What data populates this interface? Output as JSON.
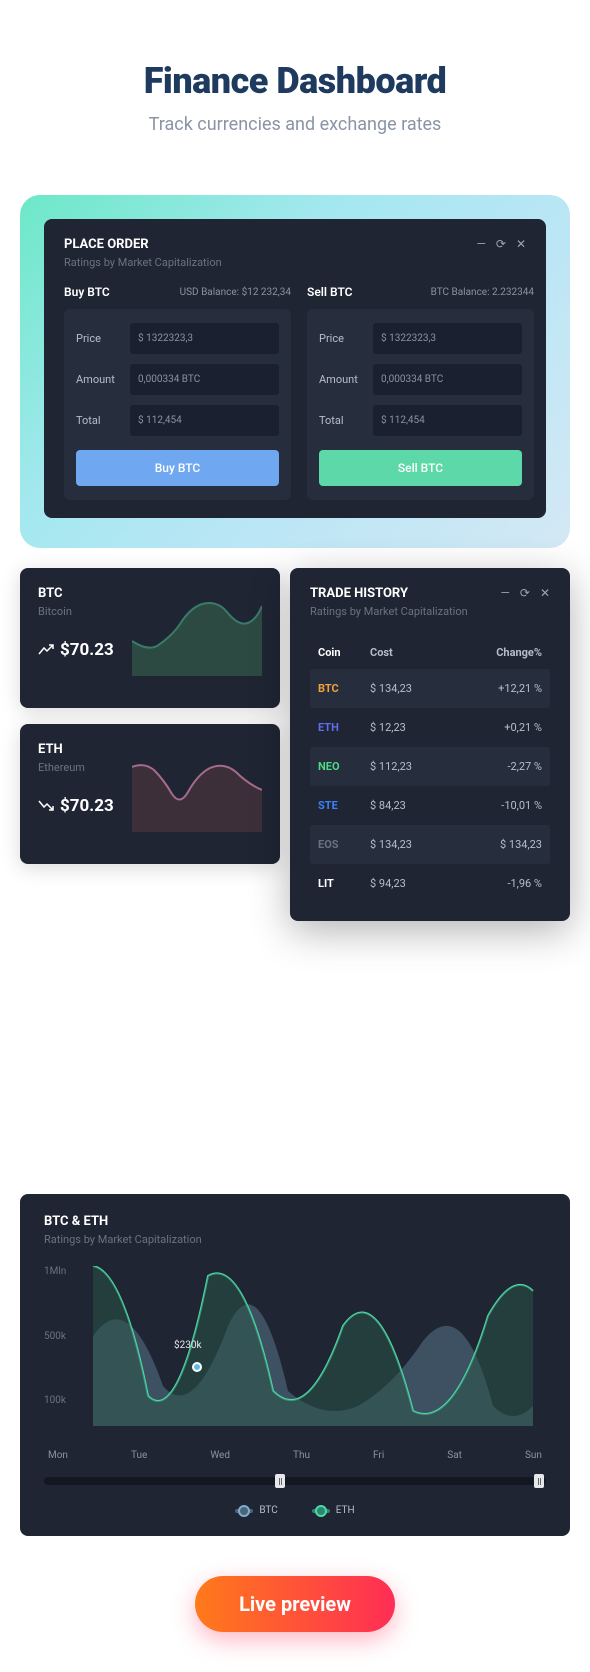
{
  "header": {
    "title": "Finance Dashboard",
    "subtitle": "Track currencies and exchange rates"
  },
  "placeOrder": {
    "title": "PLACE ORDER",
    "subtitle": "Ratings by Market Capitalization",
    "buy": {
      "title": "Buy BTC",
      "balance": "USD Balance: $12 232,34",
      "priceLabel": "Price",
      "priceValue": "$ 1322323,3",
      "amountLabel": "Amount",
      "amountValue": "0,000334 BTC",
      "totalLabel": "Total",
      "totalValue": "$ 112,454",
      "button": "Buy BTC"
    },
    "sell": {
      "title": "Sell BTC",
      "balance": "BTC Balance: 2.232344",
      "priceLabel": "Price",
      "priceValue": "$ 1322323,3",
      "amountLabel": "Amount",
      "amountValue": "0,000334 BTC",
      "totalLabel": "Total",
      "totalValue": "$ 112,454",
      "button": "Sell BTC"
    }
  },
  "miniCards": [
    {
      "symbol": "BTC",
      "name": "Bitcoin",
      "price": "$70.23",
      "trend": "up",
      "color": "#3a7a6a"
    },
    {
      "symbol": "ETH",
      "name": "Ethereum",
      "price": "$70.23",
      "trend": "down",
      "color": "#a56b8a"
    }
  ],
  "tradeHistory": {
    "title": "TRADE HISTORY",
    "subtitle": "Ratings by Market Capitalization",
    "columns": [
      "Coin",
      "Cost",
      "Change%"
    ],
    "rows": [
      {
        "coin": "BTC",
        "cost": "$ 134,23",
        "change": "+12,21 %",
        "class": "c-btc",
        "alt": true
      },
      {
        "coin": "ETH",
        "cost": "$ 12,23",
        "change": "+0,21 %",
        "class": "c-eth",
        "alt": false
      },
      {
        "coin": "NEO",
        "cost": "$ 112,23",
        "change": "-2,27 %",
        "class": "c-neo",
        "alt": true
      },
      {
        "coin": "STE",
        "cost": "$ 84,23",
        "change": "-10,01 %",
        "class": "c-ste",
        "alt": false
      },
      {
        "coin": "EOS",
        "cost": "$ 134,23",
        "change": "$ 134,23",
        "class": "c-eos",
        "alt": true
      },
      {
        "coin": "LIT",
        "cost": "$ 94,23",
        "change": "-1,96 %",
        "class": "c-lit",
        "alt": false
      }
    ]
  },
  "bigChart": {
    "title": "BTC & ETH",
    "subtitle": "Ratings by Market Capitalization",
    "yLabels": [
      "1Mln",
      "500k",
      "100k"
    ],
    "days": [
      "Mon",
      "Tue",
      "Wed",
      "Thu",
      "Fri",
      "Sat",
      "Sun"
    ],
    "tooltip": "$230k",
    "legend": [
      {
        "label": "BTC"
      },
      {
        "label": "ETH"
      }
    ]
  },
  "chart_data": {
    "type": "area",
    "title": "BTC & ETH",
    "xlabel": "",
    "ylabel": "",
    "ylim": [
      0,
      1000000
    ],
    "categories": [
      "Mon",
      "Tue",
      "Wed",
      "Thu",
      "Fri",
      "Sat",
      "Sun"
    ],
    "series": [
      {
        "name": "BTC",
        "values": [
          550000,
          230000,
          620000,
          260000,
          170000,
          500000,
          120000
        ]
      },
      {
        "name": "ETH",
        "values": [
          1000000,
          170000,
          950000,
          200000,
          620000,
          100000,
          830000
        ]
      }
    ],
    "annotation": {
      "x": "Tue",
      "value": 230000,
      "label": "$230k"
    }
  },
  "livePreview": "Live preview"
}
